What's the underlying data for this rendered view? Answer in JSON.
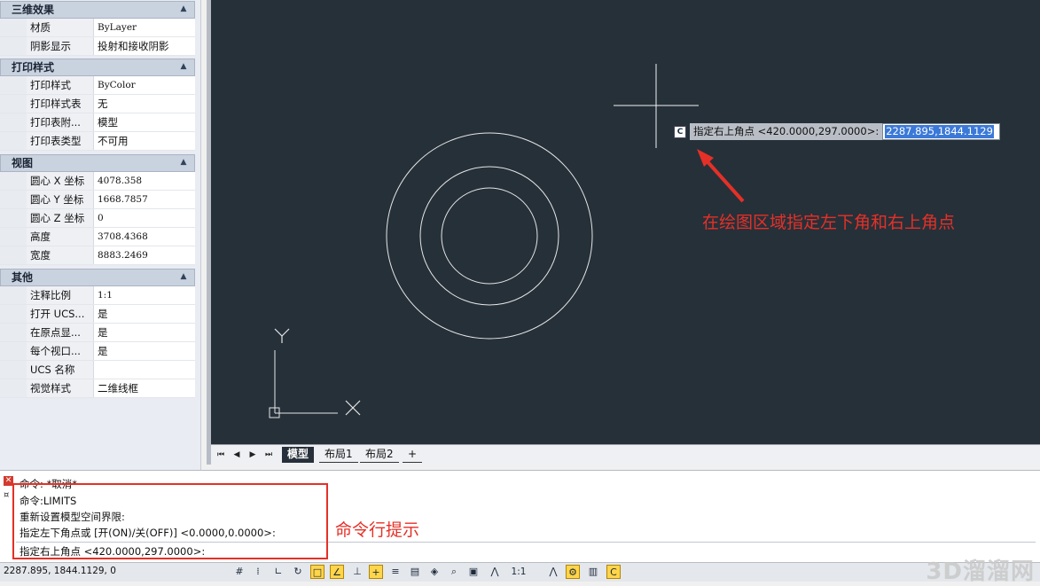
{
  "properties": {
    "sections": [
      {
        "title": "三维效果",
        "rows": [
          {
            "label": "材质",
            "value": "ByLayer"
          },
          {
            "label": "阴影显示",
            "value": "投射和接收阴影"
          }
        ]
      },
      {
        "title": "打印样式",
        "rows": [
          {
            "label": "打印样式",
            "value": "ByColor"
          },
          {
            "label": "打印样式表",
            "value": "无"
          },
          {
            "label": "打印表附...",
            "value": "模型"
          },
          {
            "label": "打印表类型",
            "value": "不可用"
          }
        ]
      },
      {
        "title": "视图",
        "rows": [
          {
            "label": "圆心 X 坐标",
            "value": "4078.358"
          },
          {
            "label": "圆心 Y 坐标",
            "value": "1668.7857"
          },
          {
            "label": "圆心 Z 坐标",
            "value": "0"
          },
          {
            "label": "高度",
            "value": "3708.4368"
          },
          {
            "label": "宽度",
            "value": "8883.2469"
          }
        ]
      },
      {
        "title": "其他",
        "rows": [
          {
            "label": "注释比例",
            "value": "1:1"
          },
          {
            "label": "打开 UCS...",
            "value": "是"
          },
          {
            "label": "在原点显...",
            "value": "是"
          },
          {
            "label": "每个视口...",
            "value": "是"
          },
          {
            "label": "UCS 名称",
            "value": ""
          },
          {
            "label": "视觉样式",
            "value": "二维线框"
          }
        ]
      }
    ]
  },
  "tooltip": {
    "icon": "C",
    "prompt": "指定右上角点 <420.0000,297.0000>:",
    "input": "2287.895,1844.1129"
  },
  "ucs": {
    "y": "Y",
    "x": "X"
  },
  "tabs": {
    "model": "模型",
    "layout1": "布局1",
    "layout2": "布局2",
    "add": "+"
  },
  "command": {
    "lines": [
      "命令: *取消*",
      "命令:LIMITS",
      "重新设置模型空间界限:",
      "指定左下角点或 [开(ON)/关(OFF)] <0.0000,0.0000>:"
    ],
    "current": "指定右上角点 <420.0000,297.0000>:"
  },
  "status": {
    "coords": "2287.895, 1844.1129, 0",
    "scale": "1:1"
  },
  "annotations": {
    "drawing": "在绘图区域指定左下角和右上角点",
    "cmdline": "命令行提示"
  },
  "watermark": "3D溜溜网",
  "colors": {
    "canvas": "#263039",
    "annotation": "#e53027",
    "selection": "#3b79d8"
  }
}
